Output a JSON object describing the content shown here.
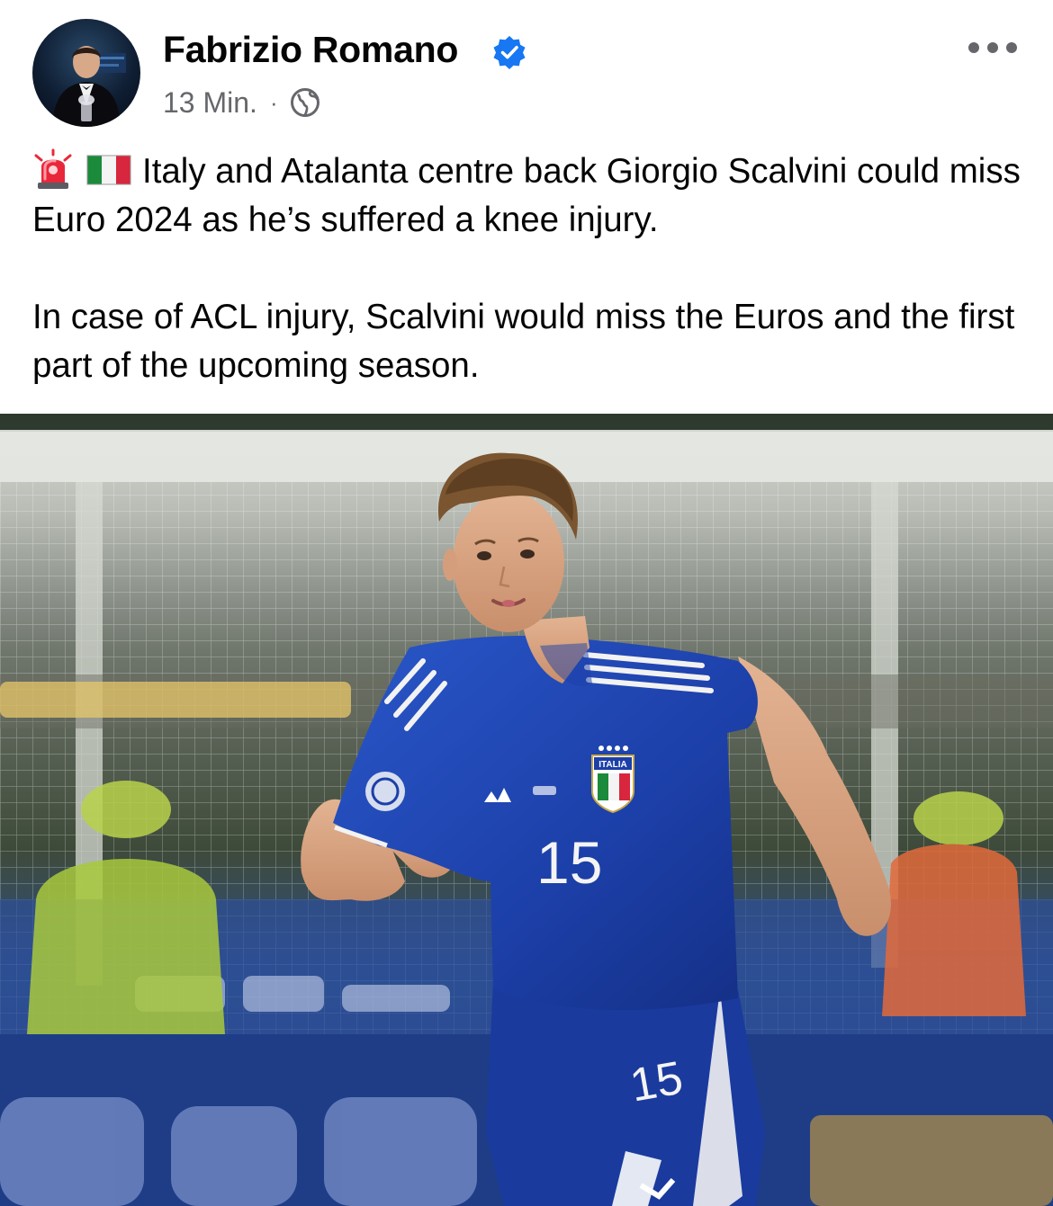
{
  "post": {
    "author": {
      "name": "Fabrizio Romano",
      "verified_icon": "verified-badge-icon",
      "avatar_icon": "profile-avatar"
    },
    "meta": {
      "time": "13 Min.",
      "separator": "·",
      "audience_icon": "globe-icon"
    },
    "menu_icon": "more-options-icon",
    "body": {
      "emojis": [
        "rotating-light-emoji",
        "italy-flag-emoji"
      ],
      "paragraph1": "Italy and Atalanta centre back Giorgio Scalvini could miss Euro 2024 as he’s suffered a knee injury.",
      "paragraph2": "In case of ACL injury, Scalvini would miss the Euros and the first part of the upcoming season."
    },
    "photo": {
      "jersey_number": "15",
      "shorts_number": "15",
      "crest_text": "ITALIA"
    }
  },
  "colors": {
    "verified_blue": "#1877f2",
    "meta_grey": "#65676b",
    "jersey_blue": "#1c3fa8"
  }
}
